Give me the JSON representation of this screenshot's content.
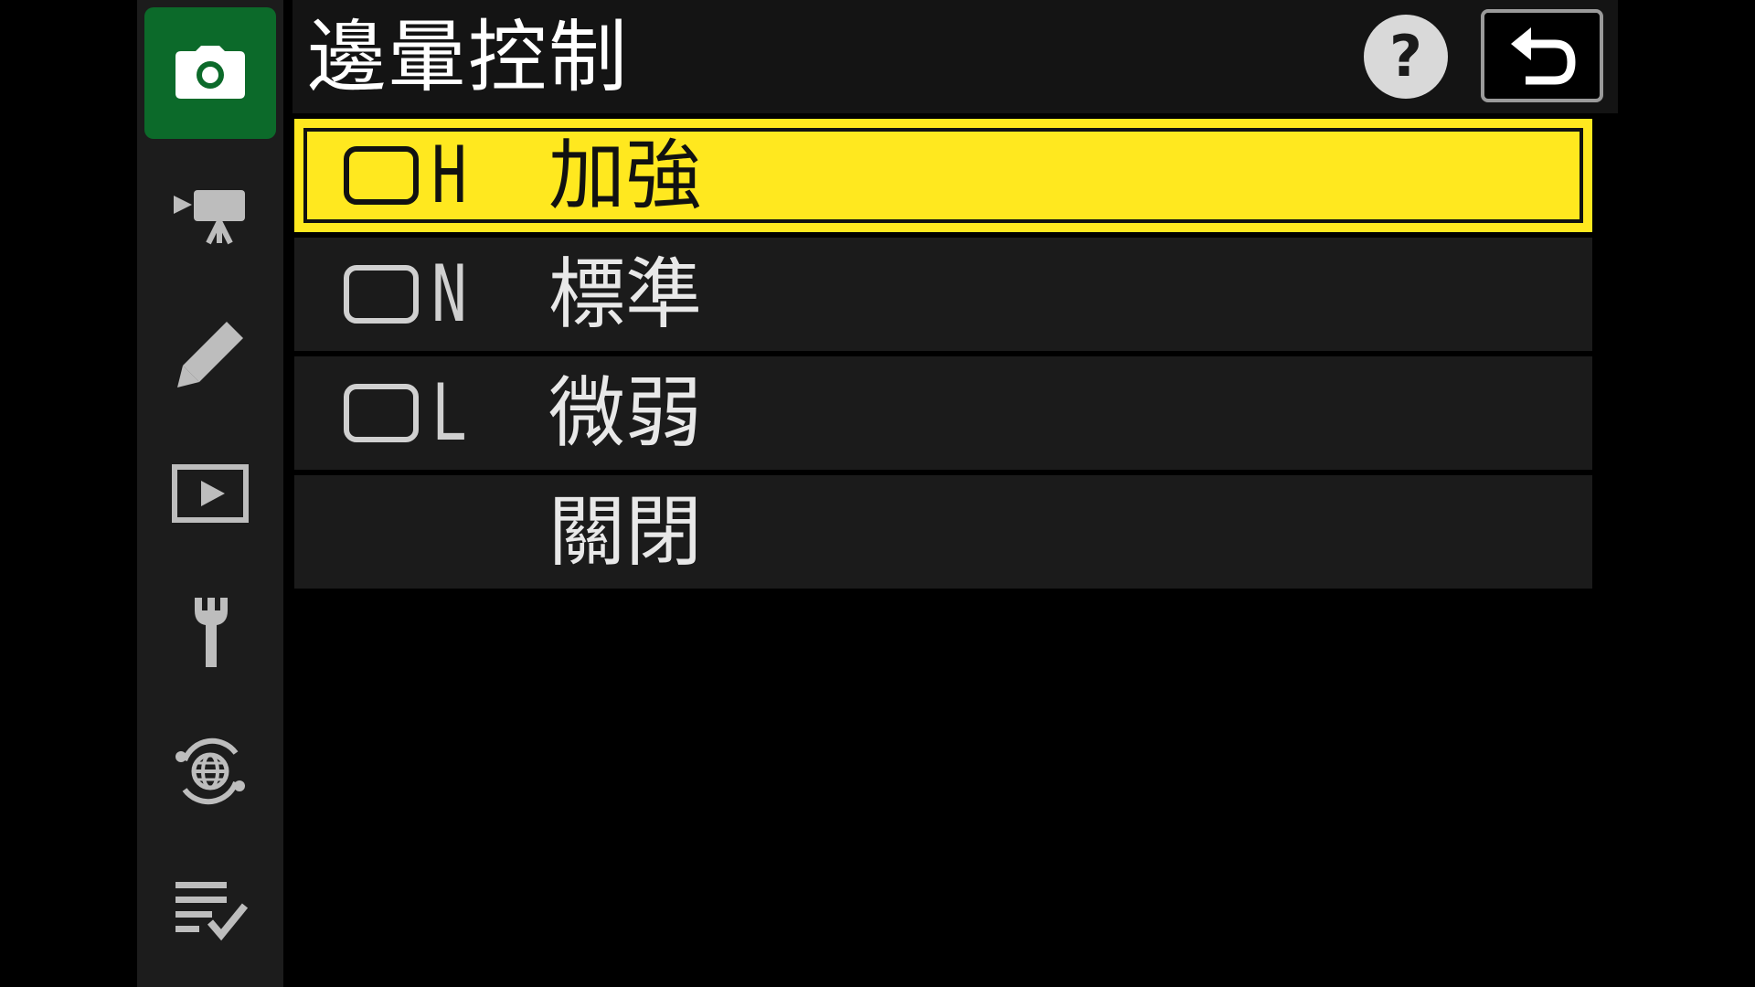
{
  "header": {
    "title": "邊暈控制",
    "help_label": "?"
  },
  "sidebar": {
    "items": [
      {
        "icon": "camera-icon",
        "active": true
      },
      {
        "icon": "movie-camera-icon",
        "active": false
      },
      {
        "icon": "pencil-icon",
        "active": false
      },
      {
        "icon": "playback-icon",
        "active": false
      },
      {
        "icon": "wrench-icon",
        "active": false
      },
      {
        "icon": "network-globe-icon",
        "active": false
      },
      {
        "icon": "my-menu-checklist-icon",
        "active": false
      }
    ]
  },
  "options": [
    {
      "code": "H",
      "label": "加強",
      "selected": true
    },
    {
      "code": "N",
      "label": "標準",
      "selected": false
    },
    {
      "code": "L",
      "label": "微弱",
      "selected": false
    },
    {
      "code": "",
      "label": "關閉",
      "selected": false
    }
  ],
  "colors": {
    "accent_selected": "#ffe81f",
    "active_tab": "#0c6a2a",
    "sidebar_bg": "#1c1c1c",
    "row_bg": "#1b1b1b"
  }
}
